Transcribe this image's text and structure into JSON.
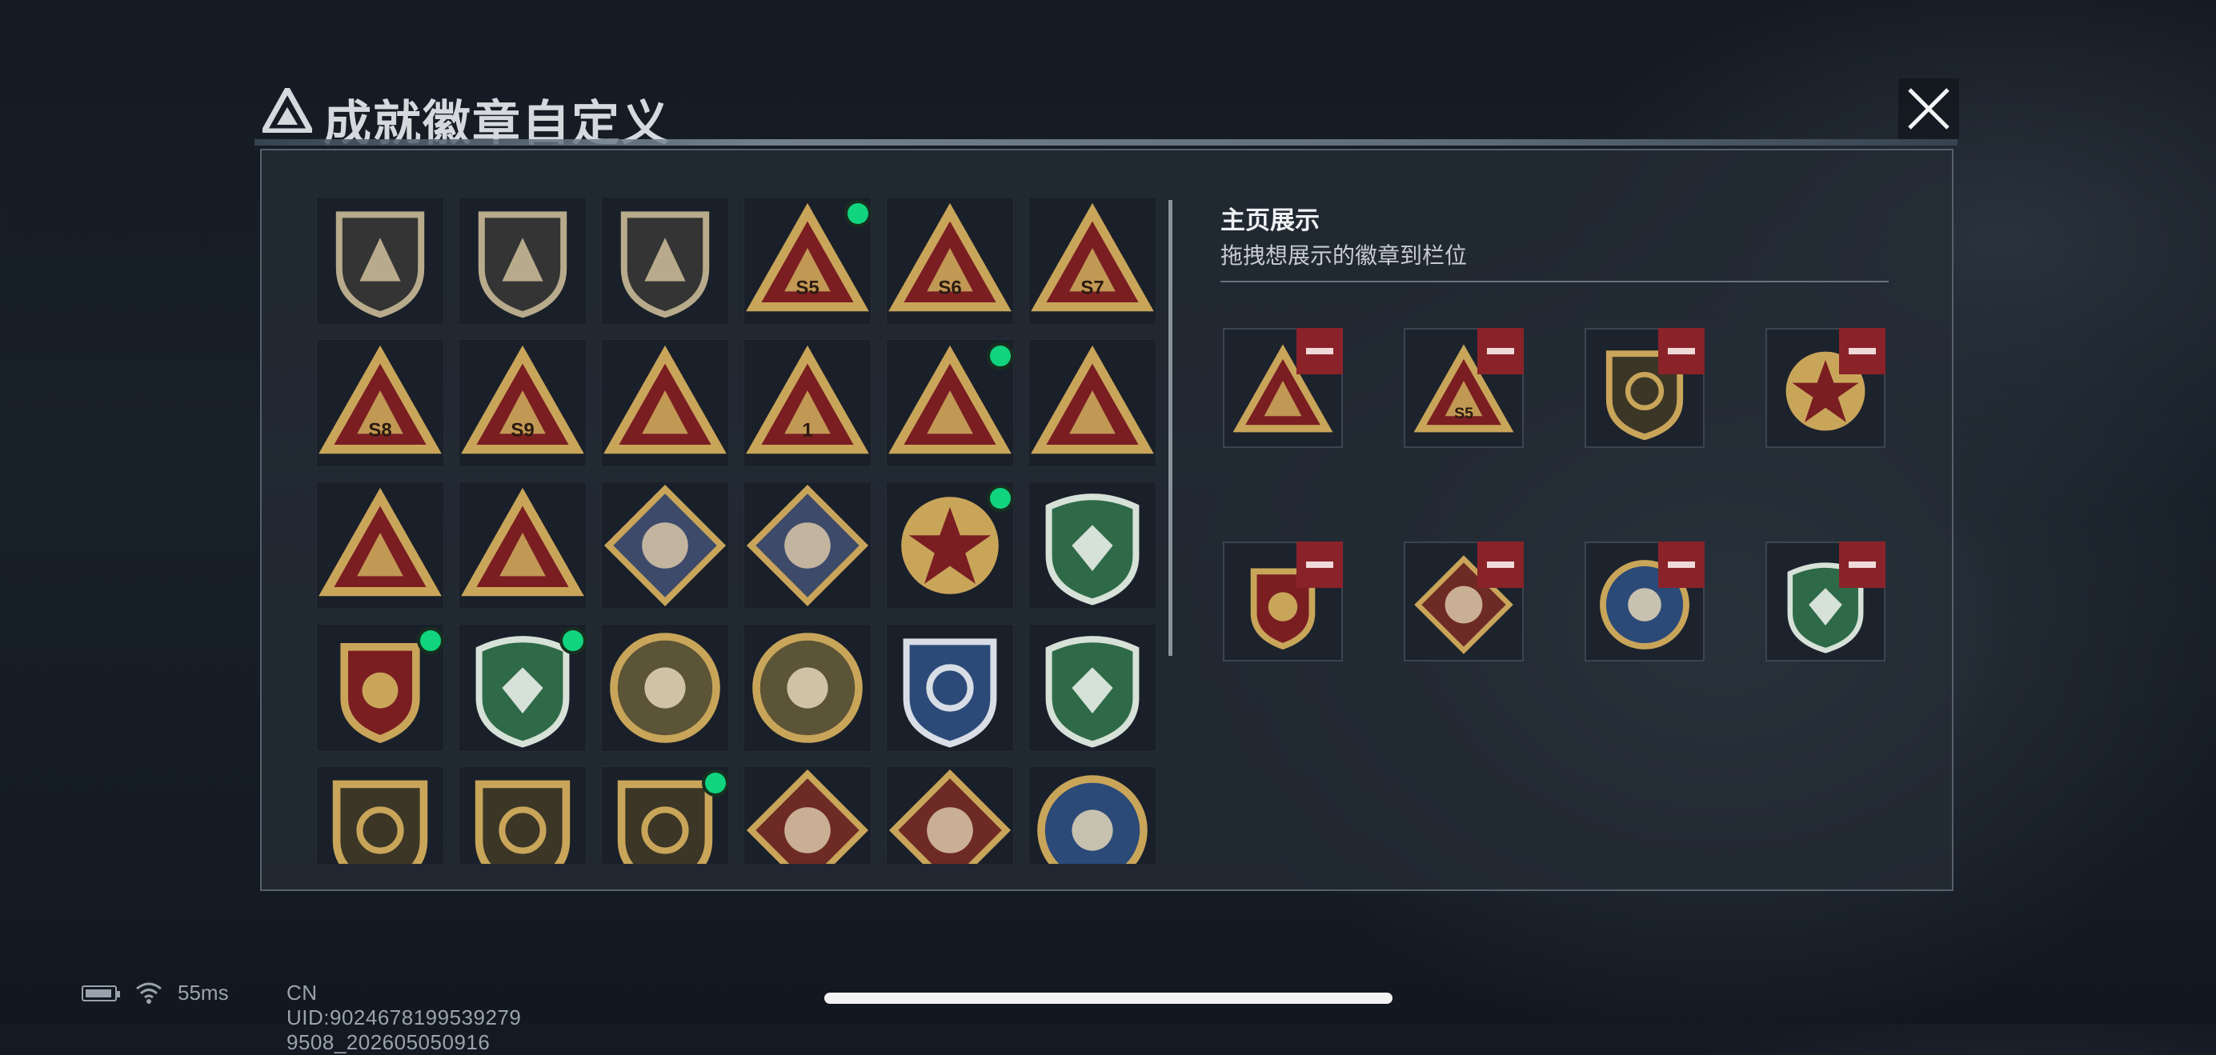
{
  "header": {
    "title": "成就徽章自定义",
    "logo_icon": "triangle-mountain-logo",
    "close_icon": "close-x-icon"
  },
  "badge_grid": {
    "rows": [
      [
        {
          "icon": "shield-triangle-badge",
          "new": false
        },
        {
          "icon": "shield-helicopter-badge",
          "new": false
        },
        {
          "icon": "shield-dagger-badge",
          "new": false
        },
        {
          "icon": "triangle-sack-badge",
          "label": "S5",
          "new": true
        },
        {
          "icon": "triangle-trophy-badge",
          "label": "S6",
          "new": false
        },
        {
          "icon": "triangle-crate-badge",
          "label": "S7",
          "new": false
        }
      ],
      [
        {
          "icon": "triangle-crate-badge",
          "label": "S8",
          "new": false
        },
        {
          "icon": "triangle-plane-badge",
          "label": "S9",
          "new": false
        },
        {
          "icon": "triangle-boat-badge",
          "new": false
        },
        {
          "icon": "triangle-number-badge",
          "label": "1",
          "new": false
        },
        {
          "icon": "triangle-flashdrive-badge",
          "new": true
        },
        {
          "icon": "triangle-dice-badge",
          "new": false
        }
      ],
      [
        {
          "icon": "triangle-squad-badge",
          "new": false
        },
        {
          "icon": "triangle-rocket-badge",
          "new": false
        },
        {
          "icon": "diamond-rose-badge",
          "new": false
        },
        {
          "icon": "diamond-launcher-badge",
          "new": false
        },
        {
          "icon": "star-emblem-badge",
          "new": true
        },
        {
          "icon": "green-shield-gem-badge",
          "new": false
        }
      ],
      [
        {
          "icon": "laurel-medal-badge",
          "new": true
        },
        {
          "icon": "green-shield-gem-badge",
          "new": true
        },
        {
          "icon": "round-crosshair-skull-badge",
          "new": false
        },
        {
          "icon": "round-crosshair-skull-badge",
          "new": false
        },
        {
          "icon": "blue-shield-crosshair-badge",
          "new": false
        },
        {
          "icon": "green-shield-crosshair-badge",
          "new": false
        }
      ],
      [
        {
          "icon": "gold-shield-rifle-badge",
          "new": false
        },
        {
          "icon": "gold-shield-rifle-badge",
          "new": false
        },
        {
          "icon": "gold-shield-crosshair-badge",
          "new": true
        },
        {
          "icon": "diamond-wolf-badge",
          "new": false
        },
        {
          "icon": "diamond-wolf-badge",
          "new": false
        },
        {
          "icon": "round-eagle-badge",
          "new": false
        }
      ]
    ]
  },
  "showcase": {
    "title": "主页展示",
    "subtitle": "拖拽想展示的徽章到栏位",
    "slots": [
      {
        "icon": "triangle-flashdrive-badge",
        "remove_icon": "minus-icon"
      },
      {
        "icon": "triangle-sack-badge",
        "label": "S5",
        "remove_icon": "minus-icon"
      },
      {
        "icon": "gold-shield-crosshair-badge",
        "remove_icon": "minus-icon"
      },
      {
        "icon": "star-emblem-badge",
        "remove_icon": "minus-icon"
      },
      {
        "icon": "laurel-medal-badge",
        "remove_icon": "minus-icon"
      },
      {
        "icon": "diamond-dragon-badge",
        "remove_icon": "minus-icon"
      },
      {
        "icon": "round-eagle-badge",
        "remove_icon": "minus-icon"
      },
      {
        "icon": "green-shield-gem-badge",
        "remove_icon": "minus-icon"
      }
    ]
  },
  "footer": {
    "battery_icon": "battery-icon",
    "wifi_icon": "wifi-icon",
    "ping": "55ms",
    "uid": "CN UID:9024678199539279 9508_202605050916"
  },
  "colors": {
    "new_dot": "#11d47f",
    "remove_button": "#8a2329",
    "badge_gold": "#c9a55a",
    "badge_red": "#7a1e22",
    "badge_green": "#2f6a48",
    "badge_blue": "#2b4a78"
  }
}
